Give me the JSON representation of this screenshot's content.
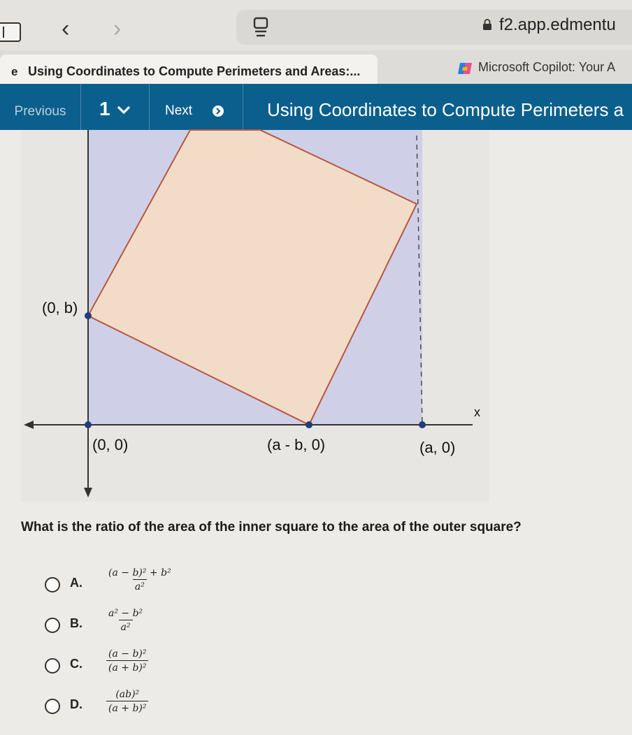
{
  "browser": {
    "url": "f2.app.edmentu",
    "tabs": [
      {
        "title": "Using Coordinates to Compute Perimeters and Areas:...",
        "icon": "edge-icon"
      },
      {
        "title": "Microsoft Copilot: Your A",
        "icon": "copilot-icon"
      }
    ]
  },
  "toolbar": {
    "previous_label": "Previous",
    "page_number": "1",
    "next_label": "Next",
    "heading": "Using Coordinates to Compute Perimeters a"
  },
  "diagram": {
    "labels": {
      "zero_b": "(0, b)",
      "origin": "(0, 0)",
      "a_minus_b": "(a - b, 0)",
      "a_zero": "(a, 0)",
      "x_axis": "x"
    },
    "colors": {
      "outer_square": "#cfd0e7",
      "inner_square": "#f2dcc7",
      "inner_border": "#b8553f",
      "point": "#1f3d7a"
    }
  },
  "question": {
    "text": "What is the ratio of the area of the inner square to the area of the outer square?",
    "options": [
      {
        "letter": "A.",
        "numerator": "(a − b)² + b²",
        "denominator": "a²"
      },
      {
        "letter": "B.",
        "numerator": "a² − b²",
        "denominator": "a²"
      },
      {
        "letter": "C.",
        "numerator": "(a − b)²",
        "denominator": "(a + b)²"
      },
      {
        "letter": "D.",
        "numerator": "(ab)²",
        "denominator": "(a + b)²"
      }
    ]
  }
}
